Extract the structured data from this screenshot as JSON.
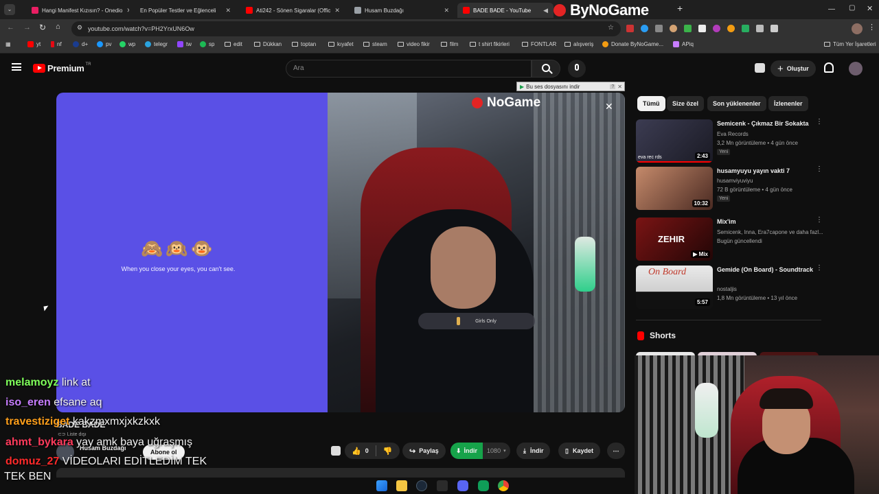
{
  "browser": {
    "tabs": [
      {
        "title": "Hangi Manifest Kızısın? - Onedio",
        "color": "#e91e63"
      },
      {
        "title": "En Popüler Testler ve Eğlenceli",
        "color": "#e91e63"
      },
      {
        "title": "Ati242 - Sönen Sigaralar (Offic",
        "color": "#ff0000"
      },
      {
        "title": "Husam Buzdağı",
        "color": "#9aa0a6"
      },
      {
        "title": "BADE BADE - YouTube",
        "color": "#ff0000"
      }
    ],
    "url": "youtube.com/watch?v=PH2YrxUN6Ow",
    "bookmarks": [
      "yt",
      "nf",
      "d+",
      "pv",
      "wp",
      "telegr",
      "tw",
      "sp",
      "edit",
      "Dükkan",
      "toptan",
      "kıyafet",
      "steam",
      "video fikir",
      "film",
      "t shirt fikirleri",
      "FONTLAR",
      "alışveriş",
      "Donate ByNoGame...",
      "APiq"
    ],
    "bookmarks_right": "Tüm Yer İşaretleri",
    "watermark": "ByNoGame",
    "add_tab": "+",
    "close_glyph": "✕"
  },
  "youtube": {
    "logo": "Premium",
    "logo_sup": "TR",
    "search_placeholder": "Ara",
    "create_label": "Oluştur",
    "download_popup": "Bu ses dosyasını indir",
    "player": {
      "emojis": "🙈🙉🐵",
      "caption": "When you close your eyes, you can't see.",
      "girls_only": "Girls Only",
      "watermark": "NoGame"
    },
    "chips": [
      "Tümü",
      "Size özel",
      "Son yüklenenler",
      "İzlenenler"
    ],
    "videos": [
      {
        "title": "Semicenk - Çıkmaz Bir Sokakta",
        "channel": "Eva Records",
        "meta": "3,2 Mn görüntüleme • 4 gün önce",
        "badge": "Yeni",
        "duration": "2:43",
        "thumb": "#2b2b3a",
        "thumb_text": "eva rec rds"
      },
      {
        "title": "husamyuyu yayın vakti 7",
        "channel": "husamviyuviyu",
        "meta": "72 B görüntüleme • 4 gün önce",
        "badge": "Yeni",
        "duration": "10:32",
        "thumb": "#8a5a4a",
        "thumb_text": ""
      },
      {
        "title": "Mix'im",
        "channel": "Semicenk, Inna, Era7capone ve daha fazl...",
        "meta": "Bugün güncellendi",
        "badge": "",
        "duration": "Mix",
        "thumb": "#5a1010",
        "thumb_text": "ZEHIR"
      },
      {
        "title": "Gemide (On Board) - Soundtrack",
        "channel": "nostaljis",
        "meta": "1,8 Mn görüntüleme • 13 yıl önce",
        "badge": "",
        "duration": "5:57",
        "thumb": "#d8d8d8",
        "thumb_text": "On Board"
      }
    ],
    "shorts_label": "Shorts",
    "video_title": "BADE BADE",
    "channel_name": "Husam Buzdağı",
    "subscribe": "Abone ol",
    "likes": "0",
    "share": "Paylaş",
    "download_green": "İndir",
    "quality": "1080",
    "download": "İndir",
    "save": "Kaydet",
    "list_badge": "Liste dışı"
  },
  "chat": [
    {
      "user": "melamoyz",
      "message": "link at",
      "color": "#7fff5a"
    },
    {
      "user": "iso_eren",
      "message": "efsane aq",
      "color": "#c77dff"
    },
    {
      "user": "travestiziget",
      "message": "kakzmxmxjxkzkxk",
      "color": "#ff9f1a"
    },
    {
      "user": "ahmt_bykara",
      "message": "yay amk baya uğraşmış",
      "color": "#ff3b5c"
    },
    {
      "user": "domuz_27",
      "message": "VİDEOLARI EDİTLEDİM TEK",
      "color": "#ff2a2a"
    }
  ],
  "chat_continuation": "TEK BEN"
}
